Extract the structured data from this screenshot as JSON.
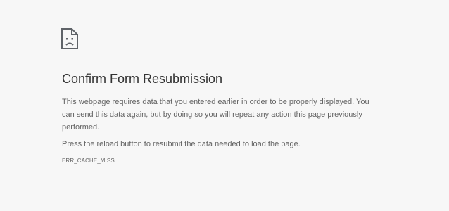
{
  "icon": {
    "name": "sad-page-icon"
  },
  "error": {
    "title": "Confirm Form Resubmission",
    "description": "This webpage requires data that you entered earlier in order to be properly displayed. You can send this data again, but by doing so you will repeat any action this page previously performed.",
    "instruction": "Press the reload button to resubmit the data needed to load the page.",
    "code": "ERR_CACHE_MISS"
  },
  "colors": {
    "background": "#f7f7f7",
    "title": "#333333",
    "body_text": "#646464",
    "icon": "#5f6368"
  }
}
